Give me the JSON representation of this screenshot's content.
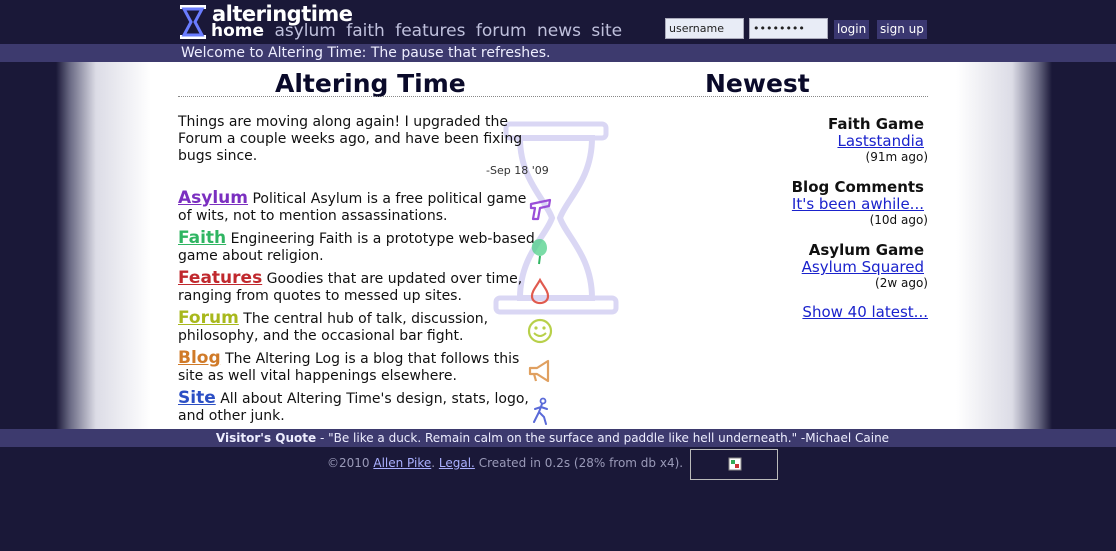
{
  "header": {
    "logo_word1": "altering",
    "logo_word2": "time",
    "nav": [
      "home",
      "asylum",
      "faith",
      "features",
      "forum",
      "news",
      "site"
    ],
    "username_value": "username",
    "password_value": "••••••••",
    "login_label": "login",
    "signup_label": "sign up"
  },
  "welcome": "Welcome to Altering Time: The pause that refreshes.",
  "main": {
    "title": "Altering Time",
    "news": "Things are moving along again! I upgraded the Forum a couple weeks ago, and have been fixing bugs since.",
    "news_date": "-Sep 18 '09",
    "sections": [
      {
        "name": "Asylum",
        "desc": "Political Asylum is a free political game of wits, not to mention assassinations.",
        "color": "#7b2fc0",
        "icon": "gun-icon"
      },
      {
        "name": "Faith",
        "desc": "Engineering Faith is a prototype web-based game about religion.",
        "color": "#2fb562",
        "icon": "balloon-icon"
      },
      {
        "name": "Features",
        "desc": "Goodies that are updated over time, ranging from quotes to messed up sites.",
        "color": "#c0282d",
        "icon": "drop-icon"
      },
      {
        "name": "Forum",
        "desc": "The central hub of talk, discussion, philosophy, and the occasional bar fight.",
        "color": "#a8b81c",
        "icon": "smiley-icon"
      },
      {
        "name": "Blog",
        "desc": "The Altering Log is a blog that follows this site as well vital happenings elsewhere.",
        "color": "#d07a28",
        "icon": "megaphone-icon"
      },
      {
        "name": "Site",
        "desc": "All about Altering Time's design, stats, logo, and other junk.",
        "color": "#2c4fc4",
        "icon": "running-man-icon"
      }
    ]
  },
  "newest": {
    "title": "Newest",
    "items": [
      {
        "category": "Faith Game",
        "link": "Laststandia",
        "ago": "(91m ago)"
      },
      {
        "category": "Blog Comments",
        "link": "It's been awhile...",
        "ago": "(10d ago)"
      },
      {
        "category": "Asylum Game",
        "link": "Asylum Squared",
        "ago": "(2w ago)"
      }
    ],
    "show_latest": "Show 40 latest..."
  },
  "footer": {
    "quote_label": "Visitor's Quote",
    "quote_text": " - \"Be like a duck. Remain calm on the surface and paddle like hell underneath.\" -Michael Caine",
    "copy_prefix": "©2010 ",
    "author_link": "Allen Pike",
    "legal_link": "Legal.",
    "created_text": " Created in 0.2s (28% from db x4)."
  },
  "colors": {
    "background": "#1a1838",
    "bar": "#3d3a6e",
    "link": "#1a22cc"
  }
}
